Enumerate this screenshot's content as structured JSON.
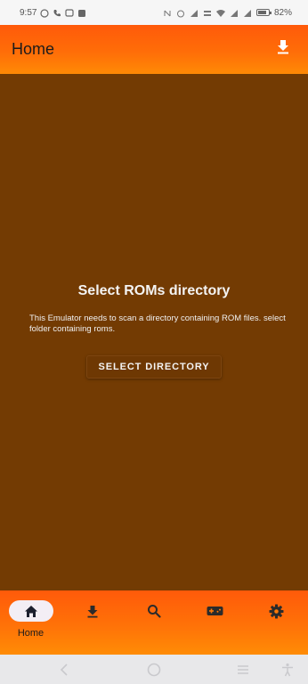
{
  "status_bar": {
    "time": "9:57",
    "battery": "82%",
    "battery_level": 0.82
  },
  "app_bar": {
    "title": "Home",
    "download_icon": "download-icon"
  },
  "main": {
    "title": "Select ROMs directory",
    "description": "This Emulator needs to scan a directory containing ROM files. select folder containing roms.",
    "button_label": "SELECT DIRECTORY"
  },
  "bottom_nav": {
    "items": [
      {
        "icon": "home-icon",
        "label": "Home",
        "active": true
      },
      {
        "icon": "download-icon",
        "label": "",
        "active": false
      },
      {
        "icon": "search-icon",
        "label": "",
        "active": false
      },
      {
        "icon": "gamepad-icon",
        "label": "",
        "active": false
      },
      {
        "icon": "gear-icon",
        "label": "",
        "active": false
      }
    ]
  },
  "colors": {
    "accent": "#ff6a08",
    "background": "#733b03",
    "text": "#f4f4f4"
  }
}
